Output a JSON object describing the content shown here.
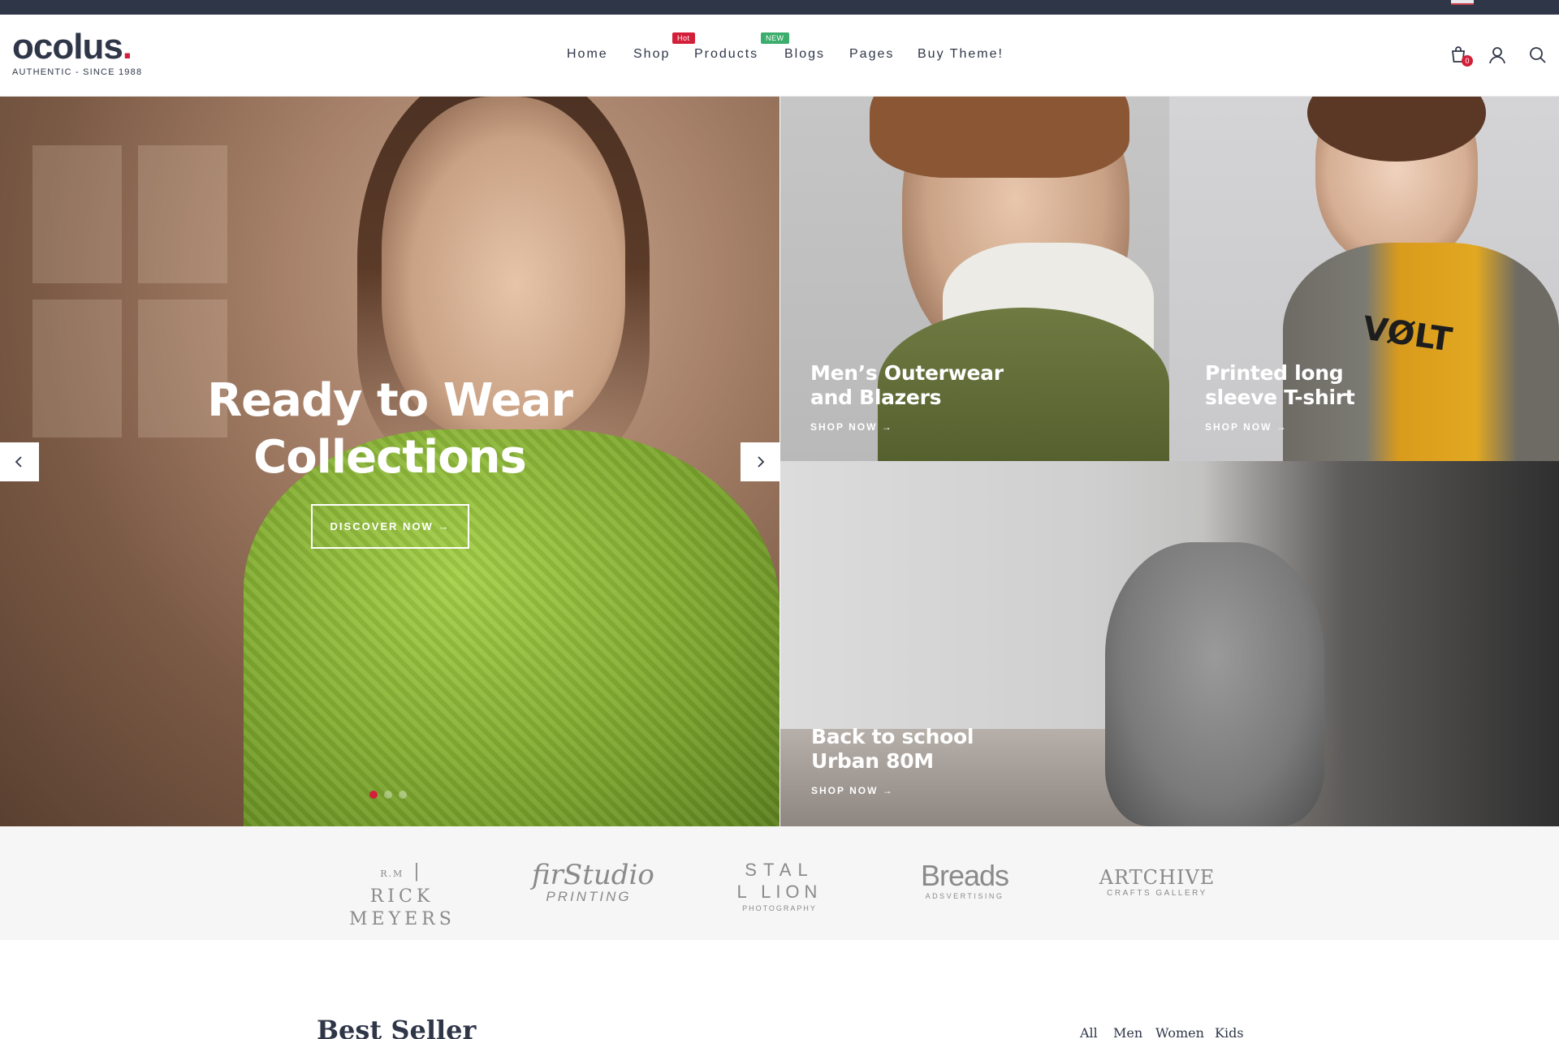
{
  "header": {
    "logo_text": "ocolus",
    "logo_dot": ".",
    "logo_tagline": "AUTHENTIC - SINCE 1988",
    "nav": [
      {
        "label": "Home"
      },
      {
        "label": "Shop",
        "badge": "Hot"
      },
      {
        "label": "Products",
        "badge": "NEW"
      },
      {
        "label": "Blogs"
      },
      {
        "label": "Pages"
      },
      {
        "label": "Buy Theme!"
      }
    ],
    "cart_count": "0",
    "icons": [
      "cart-icon",
      "user-icon",
      "search-icon"
    ]
  },
  "hero": {
    "title_line1": "Ready to Wear",
    "title_line2": "Collections",
    "cta": "DISCOVER NOW →",
    "slide_count": 3,
    "active_slide": 1
  },
  "tiles": [
    {
      "title_line1": "Men’s Outerwear",
      "title_line2": "and Blazers",
      "link": "SHOP NOW →"
    },
    {
      "title_line1": "Printed long",
      "title_line2": "sleeve T-shirt",
      "link": "SHOP NOW →"
    },
    {
      "title_line1": "Back to school",
      "title_line2": "Urban 80M",
      "link": "SHOP NOW →"
    }
  ],
  "tile_print": "VØLT",
  "brands": [
    {
      "small": "R.M",
      "line1": "RICK",
      "line2": "MEYERS"
    },
    {
      "line1": "firStudio",
      "line2": "PRINTING"
    },
    {
      "line1": "STAL",
      "line2": "L LION",
      "line3": "PHOTOGRAPHY"
    },
    {
      "line1": "Breads",
      "line2": "ADSVERTISING"
    },
    {
      "line1": "ARTCHIVE",
      "line2": "CRAFTS GALLERY"
    }
  ],
  "best_seller": {
    "title": "Best Seller",
    "filters": [
      "All",
      "Men",
      "Women",
      "Kids"
    ]
  },
  "colors": {
    "accent": "#d3203a",
    "dark": "#2f3648",
    "new_badge": "#3bad6c"
  }
}
